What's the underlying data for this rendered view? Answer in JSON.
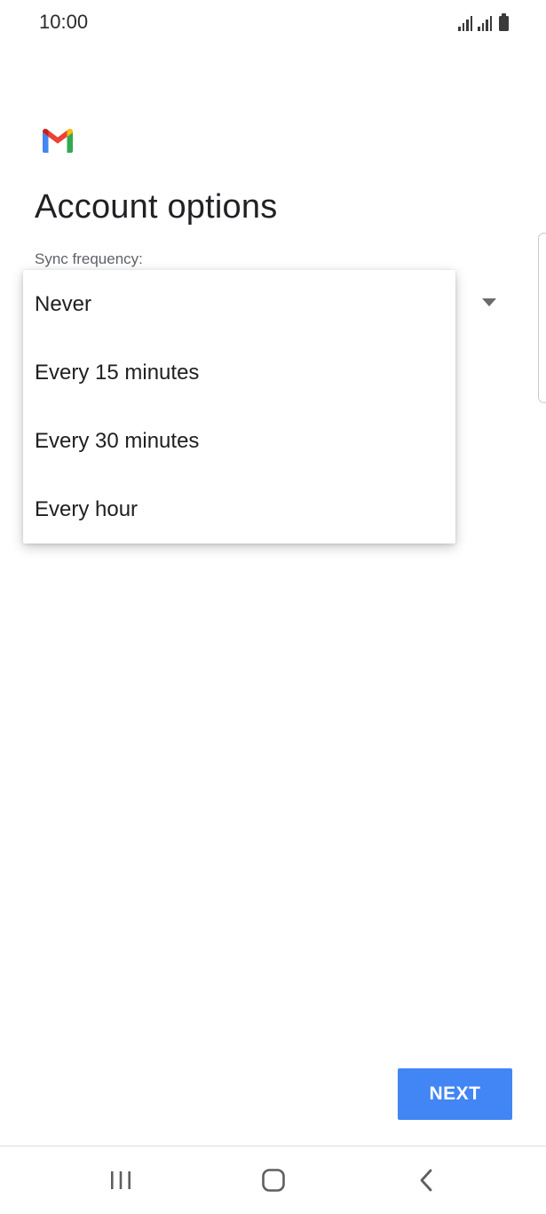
{
  "status_bar": {
    "time": "10:00",
    "icons": [
      "signal-icon",
      "signal-icon",
      "battery-icon"
    ]
  },
  "app": {
    "logo_icon": "gmail-logo",
    "brand_colors": {
      "red": "#ea4335",
      "blue": "#4285f4",
      "green": "#34a853",
      "yellow": "#fbbc04",
      "dark_red": "#c5221f"
    }
  },
  "page": {
    "title": "Account options",
    "sync_label": "Sync frequency:"
  },
  "dropdown": {
    "options": [
      {
        "label": "Never"
      },
      {
        "label": "Every 15 minutes"
      },
      {
        "label": "Every 30 minutes"
      },
      {
        "label": "Every hour"
      }
    ]
  },
  "actions": {
    "next_label": "NEXT",
    "next_color": "#4285f4"
  },
  "nav_bar": {
    "items": [
      "recents-icon",
      "home-icon",
      "back-icon"
    ]
  }
}
